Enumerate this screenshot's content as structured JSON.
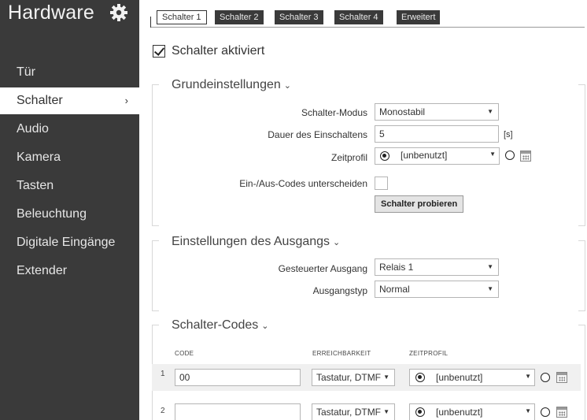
{
  "sidebar": {
    "title": "Hardware",
    "gear_icon": "gear-icon",
    "items": [
      {
        "label": "Tür"
      },
      {
        "label": "Schalter",
        "active": true
      },
      {
        "label": "Audio"
      },
      {
        "label": "Kamera"
      },
      {
        "label": "Tasten"
      },
      {
        "label": "Beleuchtung"
      },
      {
        "label": "Digitale Eingänge"
      },
      {
        "label": "Extender"
      }
    ],
    "active_chevron": "›"
  },
  "tabs": [
    {
      "label": "Schalter 1",
      "active": true
    },
    {
      "label": "Schalter 2"
    },
    {
      "label": "Schalter 3"
    },
    {
      "label": "Schalter 4"
    },
    {
      "label": "Erweitert"
    }
  ],
  "enabled": {
    "label": "Schalter aktiviert",
    "checked": true
  },
  "grund": {
    "title": "Grundeinstellungen",
    "mode_label": "Schalter-Modus",
    "mode_value": "Monostabil",
    "duration_label": "Dauer des Einschaltens",
    "duration_value": "5",
    "duration_unit": "[s]",
    "profile_label": "Zeitprofil",
    "profile_value": "[unbenutzt]",
    "codes_label": "Ein-/Aus-Codes unterscheiden",
    "test_button": "Schalter probieren"
  },
  "ausgang": {
    "title": "Einstellungen des Ausgangs",
    "output_label": "Gesteuerter Ausgang",
    "output_value": "Relais 1",
    "type_label": "Ausgangstyp",
    "type_value": "Normal"
  },
  "codes": {
    "title": "Schalter-Codes",
    "col_code": "CODE",
    "col_reach": "ERREICHBARKEIT",
    "col_profile": "ZEITPROFIL",
    "rows": [
      {
        "num": "1",
        "code": "00",
        "reach": "Tastatur, DTMF",
        "profile": "[unbenutzt]"
      },
      {
        "num": "2",
        "code": "",
        "reach": "Tastatur, DTMF",
        "profile": "[unbenutzt]"
      }
    ]
  },
  "colors": {
    "sidebar_bg": "#3a3a3a",
    "active_bg": "#ffffff",
    "row_bg": "#f0f0f0"
  }
}
